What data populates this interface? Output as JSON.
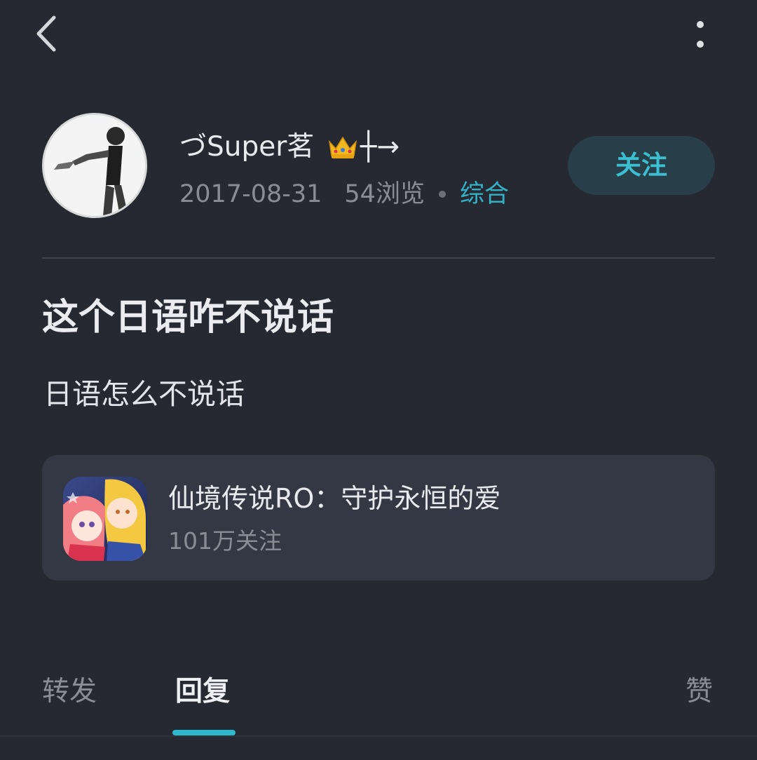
{
  "header": {
    "back_icon": "chevron-left-icon",
    "more_icon": "more-vertical-icon"
  },
  "author": {
    "name": "づSuper茗",
    "name_suffix": "┼→",
    "badge_icon": "crown-icon",
    "date": "2017-08-31",
    "views": "54浏览",
    "category": "综合",
    "follow_label": "关注"
  },
  "post": {
    "title": "这个日语咋不说话",
    "body": "日语怎么不说话"
  },
  "game_card": {
    "name": "仙境传说RO：守护永恒的爱",
    "followers": "101万关注"
  },
  "tabs": {
    "items": [
      {
        "label": "转发"
      },
      {
        "label": "回复"
      },
      {
        "label": "赞"
      }
    ],
    "active": "回复"
  },
  "colors": {
    "background": "#262832",
    "accent": "#33b3c6",
    "card": "#343744",
    "follow_button": "#283e48"
  }
}
